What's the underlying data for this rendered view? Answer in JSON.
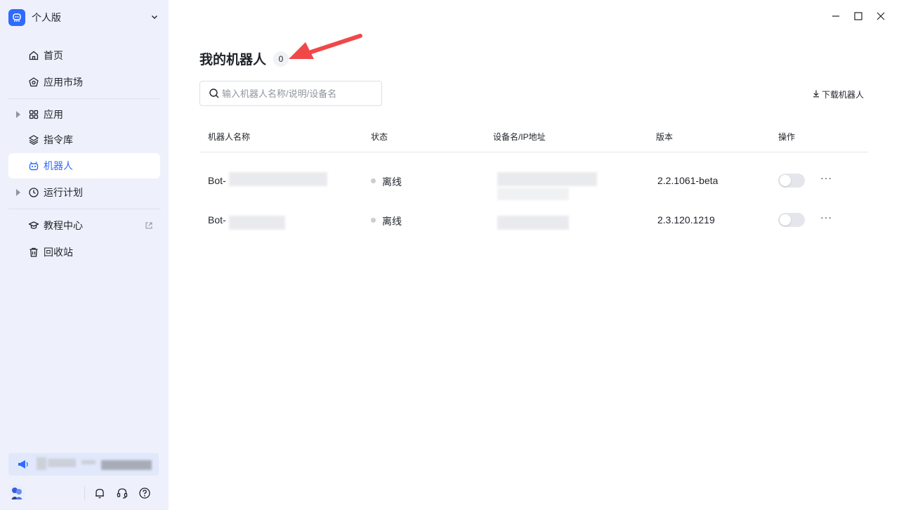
{
  "workspace": {
    "name": "个人版",
    "icon": "robot-logo-icon"
  },
  "sidebar": {
    "items": [
      {
        "label": "首页",
        "icon": "home-icon"
      },
      {
        "label": "应用市场",
        "icon": "market-icon"
      },
      {
        "label": "应用",
        "icon": "grid-icon",
        "expandable": true
      },
      {
        "label": "指令库",
        "icon": "layers-icon"
      },
      {
        "label": "机器人",
        "icon": "robot-icon",
        "active": true
      },
      {
        "label": "运行计划",
        "icon": "clock-icon",
        "expandable": true
      },
      {
        "label": "教程中心",
        "icon": "graduation-cap-icon",
        "external": true
      },
      {
        "label": "回收站",
        "icon": "trash-icon"
      }
    ],
    "notice_icon": "megaphone-icon"
  },
  "page": {
    "title": "我的机器人",
    "count": "0",
    "search_placeholder": "输入机器人名称/说明/设备名",
    "download_label": "下载机器人"
  },
  "table": {
    "columns": [
      "机器人名称",
      "状态",
      "设备名/IP地址",
      "版本",
      "操作"
    ],
    "rows": [
      {
        "name": "Bot-",
        "status": "离线",
        "version": "2.2.1061-beta",
        "enabled": false
      },
      {
        "name": "Bot-",
        "status": "离线",
        "version": "2.3.120.1219",
        "enabled": false
      }
    ]
  },
  "colors": {
    "accent": "#2f6bff",
    "sidebar_bg": "#eef1fb",
    "annotation_arrow": "#f04848"
  }
}
